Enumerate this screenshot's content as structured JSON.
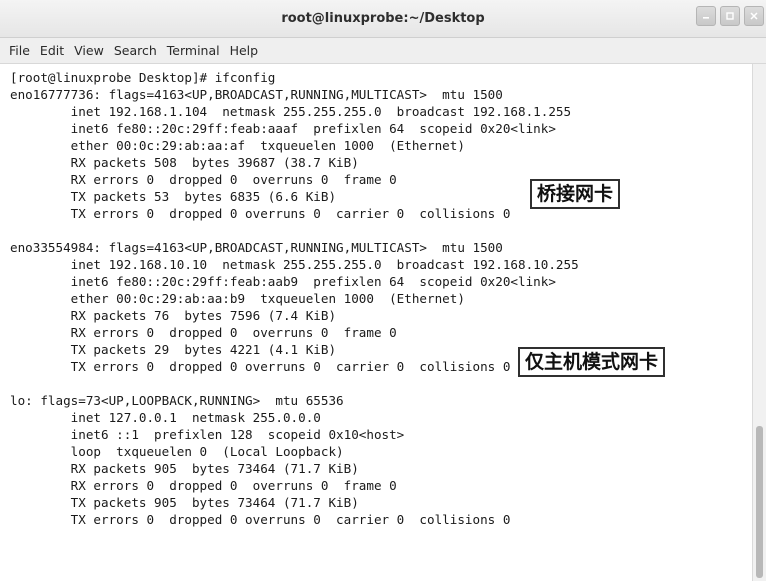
{
  "window": {
    "title": "root@linuxprobe:~/Desktop"
  },
  "menu": {
    "items": [
      "File",
      "Edit",
      "View",
      "Search",
      "Terminal",
      "Help"
    ]
  },
  "terminal": {
    "lines": [
      "[root@linuxprobe Desktop]# ifconfig",
      "eno16777736: flags=4163<UP,BROADCAST,RUNNING,MULTICAST>  mtu 1500",
      "        inet 192.168.1.104  netmask 255.255.255.0  broadcast 192.168.1.255",
      "        inet6 fe80::20c:29ff:feab:aaaf  prefixlen 64  scopeid 0x20<link>",
      "        ether 00:0c:29:ab:aa:af  txqueuelen 1000  (Ethernet)",
      "        RX packets 508  bytes 39687 (38.7 KiB)",
      "        RX errors 0  dropped 0  overruns 0  frame 0",
      "        TX packets 53  bytes 6835 (6.6 KiB)",
      "        TX errors 0  dropped 0 overruns 0  carrier 0  collisions 0",
      "",
      "eno33554984: flags=4163<UP,BROADCAST,RUNNING,MULTICAST>  mtu 1500",
      "        inet 192.168.10.10  netmask 255.255.255.0  broadcast 192.168.10.255",
      "        inet6 fe80::20c:29ff:feab:aab9  prefixlen 64  scopeid 0x20<link>",
      "        ether 00:0c:29:ab:aa:b9  txqueuelen 1000  (Ethernet)",
      "        RX packets 76  bytes 7596 (7.4 KiB)",
      "        RX errors 0  dropped 0  overruns 0  frame 0",
      "        TX packets 29  bytes 4221 (4.1 KiB)",
      "        TX errors 0  dropped 0 overruns 0  carrier 0  collisions 0",
      "",
      "lo: flags=73<UP,LOOPBACK,RUNNING>  mtu 65536",
      "        inet 127.0.0.1  netmask 255.0.0.0",
      "        inet6 ::1  prefixlen 128  scopeid 0x10<host>",
      "        loop  txqueuelen 0  (Local Loopback)",
      "        RX packets 905  bytes 73464 (71.7 KiB)",
      "        RX errors 0  dropped 0  overruns 0  frame 0",
      "        TX packets 905  bytes 73464 (71.7 KiB)",
      "        TX errors 0  dropped 0 overruns 0  carrier 0  collisions 0"
    ]
  },
  "annotations": {
    "bridged_nic": "桥接网卡",
    "hostonly_nic": "仅主机模式网卡"
  },
  "icons": {
    "minimize": "minimize-icon",
    "maximize": "maximize-icon",
    "close": "close-icon"
  }
}
